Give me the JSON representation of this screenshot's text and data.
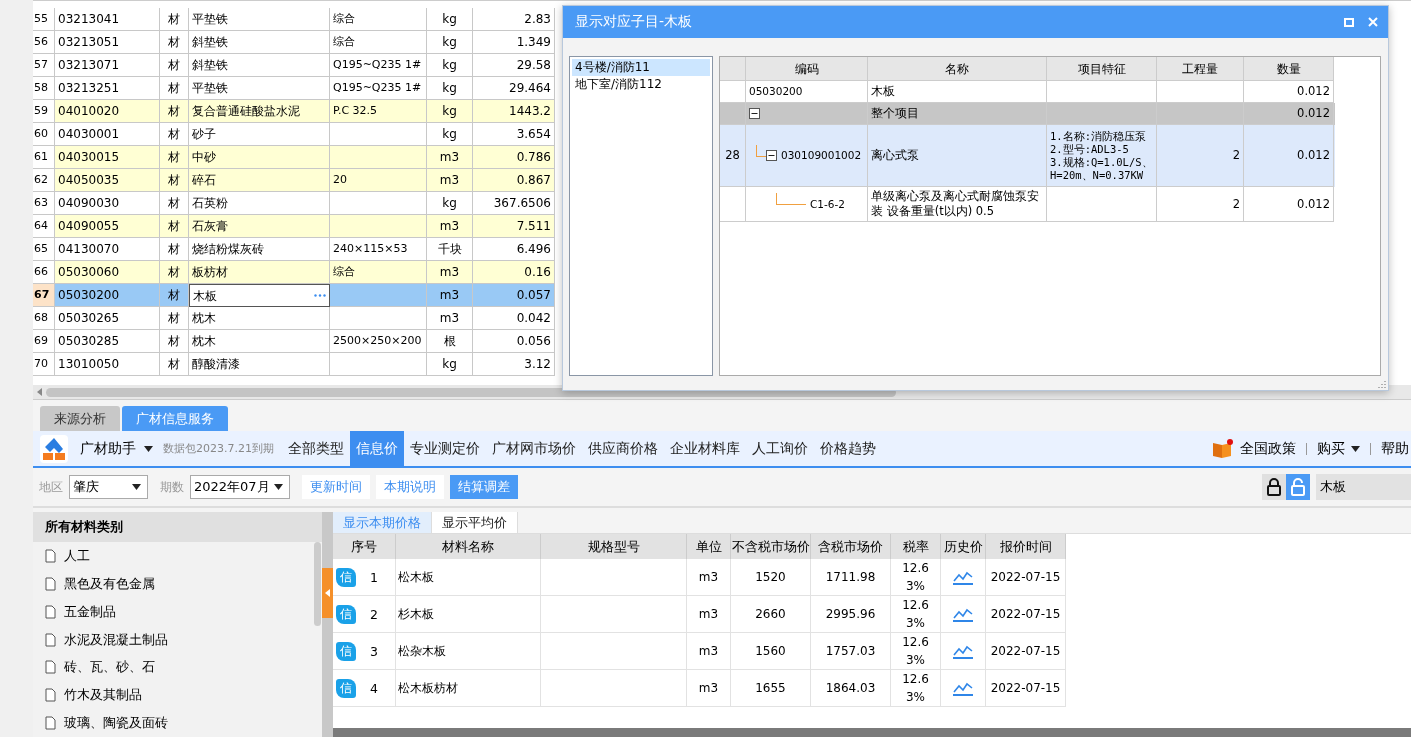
{
  "materials_table": {
    "rows": [
      {
        "no": "55",
        "code": "03213041",
        "type": "材",
        "name": "平垫铁",
        "spec": "综合",
        "unit": "kg",
        "quantity": "2.83",
        "highlighted": false,
        "selected": false
      },
      {
        "no": "56",
        "code": "03213051",
        "type": "材",
        "name": "斜垫铁",
        "spec": "综合",
        "unit": "kg",
        "quantity": "1.349",
        "highlighted": false,
        "selected": false
      },
      {
        "no": "57",
        "code": "03213071",
        "type": "材",
        "name": "斜垫铁",
        "spec": "Q195~Q235 1#",
        "unit": "kg",
        "quantity": "29.58",
        "highlighted": false,
        "selected": false
      },
      {
        "no": "58",
        "code": "03213251",
        "type": "材",
        "name": "平垫铁",
        "spec": "Q195~Q235 1#",
        "unit": "kg",
        "quantity": "29.464",
        "highlighted": false,
        "selected": false
      },
      {
        "no": "59",
        "code": "04010020",
        "type": "材",
        "name": "复合普通硅酸盐水泥",
        "spec": "P.C 32.5",
        "unit": "kg",
        "quantity": "1443.2",
        "highlighted": true,
        "selected": false
      },
      {
        "no": "60",
        "code": "04030001",
        "type": "材",
        "name": "砂子",
        "spec": "",
        "unit": "kg",
        "quantity": "3.654",
        "highlighted": false,
        "selected": false
      },
      {
        "no": "61",
        "code": "04030015",
        "type": "材",
        "name": "中砂",
        "spec": "",
        "unit": "m3",
        "quantity": "0.786",
        "highlighted": true,
        "selected": false
      },
      {
        "no": "62",
        "code": "04050035",
        "type": "材",
        "name": "碎石",
        "spec": "20",
        "unit": "m3",
        "quantity": "0.867",
        "highlighted": true,
        "selected": false
      },
      {
        "no": "63",
        "code": "04090030",
        "type": "材",
        "name": "石英粉",
        "spec": "",
        "unit": "kg",
        "quantity": "367.6506",
        "highlighted": false,
        "selected": false
      },
      {
        "no": "64",
        "code": "04090055",
        "type": "材",
        "name": "石灰膏",
        "spec": "",
        "unit": "m3",
        "quantity": "7.511",
        "highlighted": true,
        "selected": false
      },
      {
        "no": "65",
        "code": "04130070",
        "type": "材",
        "name": "烧结粉煤灰砖",
        "spec": "240×115×53",
        "unit": "千块",
        "quantity": "6.496",
        "highlighted": false,
        "selected": false
      },
      {
        "no": "66",
        "code": "05030060",
        "type": "材",
        "name": "板枋材",
        "spec": "综合",
        "unit": "m3",
        "quantity": "0.16",
        "highlighted": true,
        "selected": false
      },
      {
        "no": "67",
        "code": "05030200",
        "type": "材",
        "name": "木板",
        "spec": "",
        "unit": "m3",
        "quantity": "0.057",
        "highlighted": false,
        "selected": true
      },
      {
        "no": "68",
        "code": "05030265",
        "type": "材",
        "name": "枕木",
        "spec": "",
        "unit": "m3",
        "quantity": "0.042",
        "highlighted": false,
        "selected": false
      },
      {
        "no": "69",
        "code": "05030285",
        "type": "材",
        "name": "枕木",
        "spec": "2500×250×200",
        "unit": "根",
        "quantity": "0.056",
        "highlighted": false,
        "selected": false
      },
      {
        "no": "70",
        "code": "13010050",
        "type": "材",
        "name": "醇酸清漆",
        "spec": "",
        "unit": "kg",
        "quantity": "3.12",
        "highlighted": false,
        "selected": false
      }
    ]
  },
  "dialog": {
    "title": "显示对应子目-木板",
    "locations": [
      {
        "label": "4号楼/消防11",
        "selected": true
      },
      {
        "label": "地下室/消防112",
        "selected": false
      }
    ],
    "grid": {
      "columns": [
        "编码",
        "名称",
        "项目特征",
        "工程量",
        "数量"
      ],
      "rows": [
        {
          "kind": "material",
          "code": "05030200",
          "name": "木板",
          "quantity": "0.012"
        },
        {
          "kind": "group",
          "name": "整个项目",
          "quantity": "0.012",
          "expanded": true,
          "children": [
            {
              "kind": "item",
              "no": "28",
              "code": "030109001002",
              "name": "离心式泵",
              "features": [
                "1.名称:消防稳压泵",
                "2.型号:ADL3-5",
                "3.规格:Q=1.0L/S、H=20m、N=0.37KW"
              ],
              "work_qty": "2",
              "quantity": "0.012",
              "expanded": true,
              "children": [
                {
                  "kind": "norm",
                  "code": "C1-6-2",
                  "name": "单级离心泵及离心式耐腐蚀泵安装 设备重量(t以内) 0.5",
                  "work_qty": "2",
                  "quantity": "0.012"
                }
              ]
            }
          ]
        }
      ]
    }
  },
  "panel_tabs": [
    {
      "label": "来源分析",
      "selected": false
    },
    {
      "label": "广材信息服务",
      "selected": true
    }
  ],
  "toolbar": {
    "app_name": "广材助手",
    "package_note": "数据包2023.7.21到期",
    "nav": [
      {
        "label": "全部类型",
        "selected": false
      },
      {
        "label": "信息价",
        "selected": true
      },
      {
        "label": "专业测定价",
        "selected": false
      },
      {
        "label": "广材网市场价",
        "selected": false
      },
      {
        "label": "供应商价格",
        "selected": false
      },
      {
        "label": "企业材料库",
        "selected": false
      },
      {
        "label": "人工询价",
        "selected": false
      },
      {
        "label": "价格趋势",
        "selected": false
      }
    ],
    "policy": "全国政策",
    "buy": "购买",
    "help": "帮助"
  },
  "filter": {
    "region_label": "地区",
    "region": "肇庆",
    "period_label": "期数",
    "period": "2022年07月",
    "buttons": [
      {
        "label": "更新时间",
        "selected": false
      },
      {
        "label": "本期说明",
        "selected": false
      },
      {
        "label": "结算调差",
        "selected": true
      }
    ],
    "locks": [
      {
        "kind": "locked",
        "selected": false
      },
      {
        "kind": "unlocked",
        "selected": true
      }
    ],
    "search": "木板"
  },
  "categories": {
    "title": "所有材料类别",
    "items": [
      "人工",
      "黑色及有色金属",
      "五金制品",
      "水泥及混凝土制品",
      "砖、瓦、砂、石",
      "竹木及其制品",
      "玻璃、陶瓷及面砖"
    ]
  },
  "price_tabs": [
    {
      "label": "显示本期价格",
      "selected": true
    },
    {
      "label": "显示平均价",
      "selected": false
    }
  ],
  "price_table": {
    "columns": [
      "序号",
      "材料名称",
      "规格型号",
      "单位",
      "不含税市场价",
      "含税市场价",
      "税率",
      "历史价",
      "报价时间"
    ],
    "rows": [
      {
        "badge": "信",
        "no": "1",
        "name": "松木板",
        "spec": "",
        "unit": "m3",
        "price_ex_tax": "1520",
        "price_inc_tax": "1711.98",
        "tax_rate": "12.63%",
        "date": "2022-07-15"
      },
      {
        "badge": "信",
        "no": "2",
        "name": "杉木板",
        "spec": "",
        "unit": "m3",
        "price_ex_tax": "2660",
        "price_inc_tax": "2995.96",
        "tax_rate": "12.63%",
        "date": "2022-07-15"
      },
      {
        "badge": "信",
        "no": "3",
        "name": "松杂木板",
        "spec": "",
        "unit": "m3",
        "price_ex_tax": "1560",
        "price_inc_tax": "1757.03",
        "tax_rate": "12.63%",
        "date": "2022-07-15"
      },
      {
        "badge": "信",
        "no": "4",
        "name": "松木板枋材",
        "spec": "",
        "unit": "m3",
        "price_ex_tax": "1655",
        "price_inc_tax": "1864.03",
        "tax_rate": "12.63%",
        "date": "2022-07-15"
      }
    ]
  }
}
